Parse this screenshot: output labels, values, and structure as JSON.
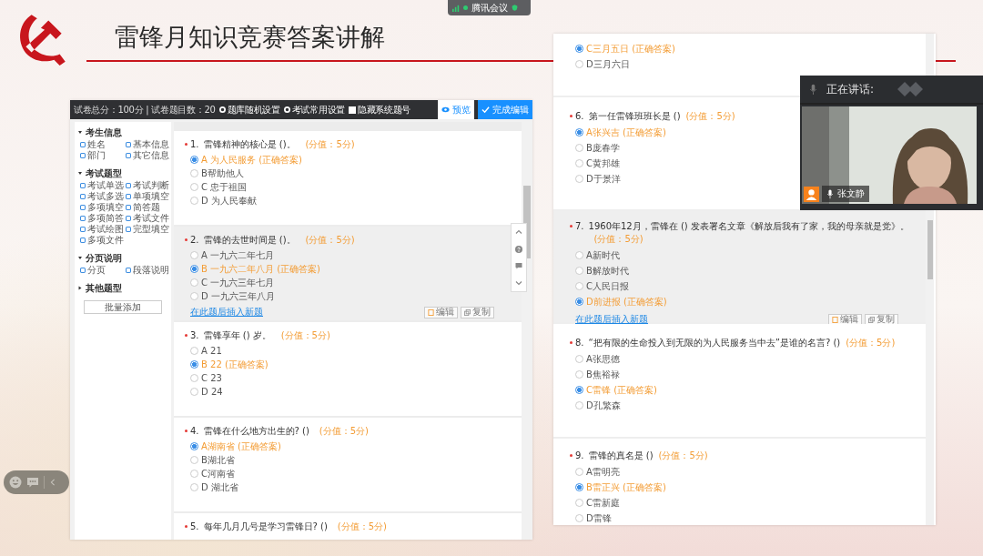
{
  "meeting": {
    "app_name": "腾讯会议"
  },
  "slide": {
    "title": "雷锋月知识竞赛答案讲解"
  },
  "left_editor": {
    "toolbar": {
      "summary": "试卷总分：100分 | 试卷题目数：20",
      "actions": [
        {
          "label": "题库随机设置",
          "kind": "settings"
        },
        {
          "label": "考试常用设置",
          "kind": "settings"
        },
        {
          "label": "隐藏系统题号",
          "kind": "checkbox",
          "checked": false
        }
      ],
      "buttons": [
        {
          "label": "预览",
          "kind": "outline"
        },
        {
          "label": "完成编辑",
          "kind": "primary"
        }
      ]
    },
    "sidebar": {
      "groups": [
        {
          "title": "考生信息",
          "expanded": true,
          "items": [
            "姓名",
            "基本信息",
            "部门",
            "其它信息"
          ]
        },
        {
          "title": "考试题型",
          "expanded": true,
          "items": [
            "考试单选",
            "考试判断",
            "考试多选",
            "单项填空",
            "多项填空",
            "简答题",
            "多项简答",
            "考试文件",
            "考试绘图",
            "完型填空",
            "多项文件"
          ]
        },
        {
          "title": "分页说明",
          "expanded": true,
          "items": [
            "分页",
            "段落说明"
          ]
        },
        {
          "title": "其他题型",
          "expanded": false
        }
      ],
      "batch_button": "批量添加"
    },
    "questions": [
      {
        "number": "1.",
        "required": true,
        "text": "雷锋精神的核心是 ()。",
        "score": "(分值：5分)",
        "hovered": false,
        "options": [
          {
            "label": "A 为人民服务 (正确答案)",
            "selected": true
          },
          {
            "label": "B帮助他人",
            "selected": false
          },
          {
            "label": "C 忠于祖国",
            "selected": false
          },
          {
            "label": "D 为人民奉献",
            "selected": false
          }
        ]
      },
      {
        "number": "2.",
        "required": true,
        "text": "雷锋的去世时间是 ()。",
        "score": "(分值：5分)",
        "hovered": true,
        "options": [
          {
            "label": "A 一九六二年七月",
            "selected": false
          },
          {
            "label": "B 一九六二年八月 (正确答案)",
            "selected": true
          },
          {
            "label": "C 一九六三年七月",
            "selected": false
          },
          {
            "label": "D 一九六三年八月",
            "selected": false
          }
        ],
        "insert_link": "在此题后插入新题",
        "actions": [
          "编辑",
          "复制"
        ]
      },
      {
        "number": "3.",
        "required": true,
        "text": "雷锋享年 () 岁。",
        "score": "(分值：5分)",
        "hovered": false,
        "options": [
          {
            "label": "A 21",
            "selected": false
          },
          {
            "label": "B 22 (正确答案)",
            "selected": true
          },
          {
            "label": "C 23",
            "selected": false
          },
          {
            "label": "D 24",
            "selected": false
          }
        ]
      },
      {
        "number": "4.",
        "required": true,
        "text": "雷锋在什么地方出生的? ()",
        "score": "(分值：5分)",
        "hovered": false,
        "options": [
          {
            "label": "A湖南省 (正确答案)",
            "selected": true
          },
          {
            "label": "B湖北省",
            "selected": false
          },
          {
            "label": "C河南省",
            "selected": false
          },
          {
            "label": "D 湖北省",
            "selected": false
          }
        ]
      },
      {
        "number": "5.",
        "required": true,
        "text": "每年几月几号是学习雷锋日? ()",
        "score": "(分值：5分)",
        "hovered": false
      }
    ]
  },
  "right_editor": {
    "questions": [
      {
        "hovered": false,
        "options": [
          {
            "label": "C三月五日 (正确答案)",
            "selected": true
          },
          {
            "label": "D三月六日",
            "selected": false
          }
        ]
      },
      {
        "number": "6.",
        "required": true,
        "text": "第一任雷锋班班长是 ()",
        "score": "(分值：5分)",
        "hovered": false,
        "options": [
          {
            "label": "A张兴吉 (正确答案)",
            "selected": true
          },
          {
            "label": "B庞春学",
            "selected": false
          },
          {
            "label": "C黄邦雄",
            "selected": false
          },
          {
            "label": "D于景洋",
            "selected": false
          }
        ]
      },
      {
        "number": "7.",
        "required": true,
        "text": "1960年12月，雷锋在 () 发表署名文章《解放后我有了家，我的母亲就是党》。",
        "score": "(分值：5分)",
        "hovered": true,
        "options": [
          {
            "label": "A新时代",
            "selected": false
          },
          {
            "label": "B解放时代",
            "selected": false
          },
          {
            "label": "C人民日报",
            "selected": false
          },
          {
            "label": "D前进报 (正确答案)",
            "selected": true
          }
        ],
        "insert_link": "在此题后插入新题",
        "actions": [
          "编辑",
          "复制"
        ]
      },
      {
        "number": "8.",
        "required": true,
        "text": "“把有限的生命投入到无限的为人民服务当中去”是谁的名言? ()",
        "score": "(分值：5分)",
        "hovered": false,
        "options": [
          {
            "label": "A张思德",
            "selected": false
          },
          {
            "label": "B焦裕禄",
            "selected": false
          },
          {
            "label": "C雷锋 (正确答案)",
            "selected": true
          },
          {
            "label": "D孔繁森",
            "selected": false
          }
        ]
      },
      {
        "number": "9.",
        "required": true,
        "text": "雷锋的真名是 ()",
        "score": "(分值：5分)",
        "hovered": false,
        "options": [
          {
            "label": "A雷明亮",
            "selected": false
          },
          {
            "label": "B雷正兴 (正确答案)",
            "selected": true
          },
          {
            "label": "C雷新庭",
            "selected": false
          },
          {
            "label": "D雷锋",
            "selected": false
          }
        ]
      }
    ]
  },
  "speaker_panel": {
    "label": "正在讲话:",
    "speaker": "张文静"
  }
}
